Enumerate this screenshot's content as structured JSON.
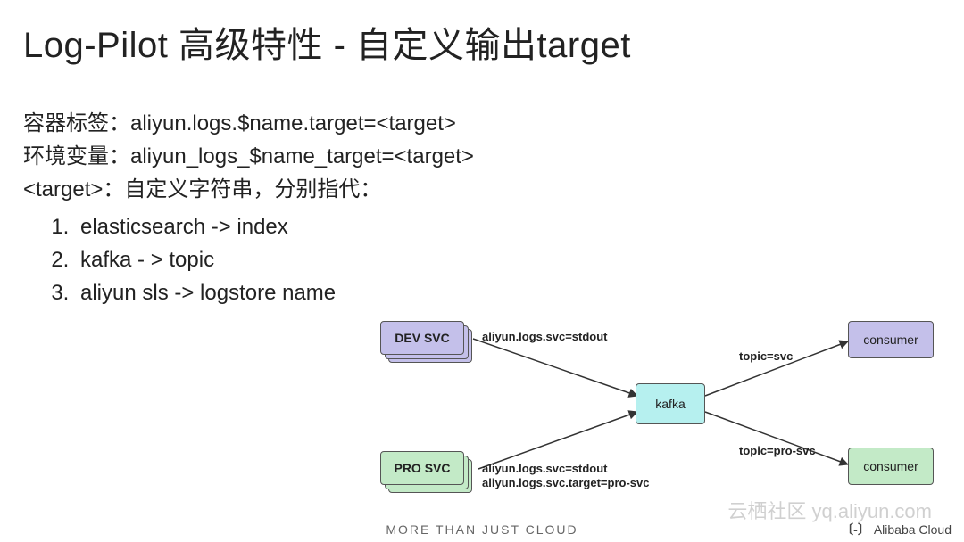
{
  "title": "Log-Pilot 高级特性 - 自定义输出target",
  "lines": {
    "label1": "容器标签：aliyun.logs.$name.target=<target>",
    "label2": "环境变量：aliyun_logs_$name_target=<target>",
    "label3": "<target>：自定义字符串，分别指代：",
    "item1": "elasticsearch -> index",
    "item2": "kafka - > topic",
    "item3": "aliyun sls -> logstore name"
  },
  "diagram": {
    "dev_svc": "DEV SVC",
    "pro_svc": "PRO SVC",
    "kafka": "kafka",
    "consumer1": "consumer",
    "consumer2": "consumer",
    "edge_dev": "aliyun.logs.svc=stdout",
    "edge_pro_line1": "aliyun.logs.svc=stdout",
    "edge_pro_line2": "aliyun.logs.svc.target=pro-svc",
    "edge_top_right": "topic=svc",
    "edge_bot_right": "topic=pro-svc"
  },
  "footer": "MORE THAN JUST CLOUD",
  "brand": "Alibaba Cloud",
  "watermark": "云栖社区 yq.aliyun.com"
}
